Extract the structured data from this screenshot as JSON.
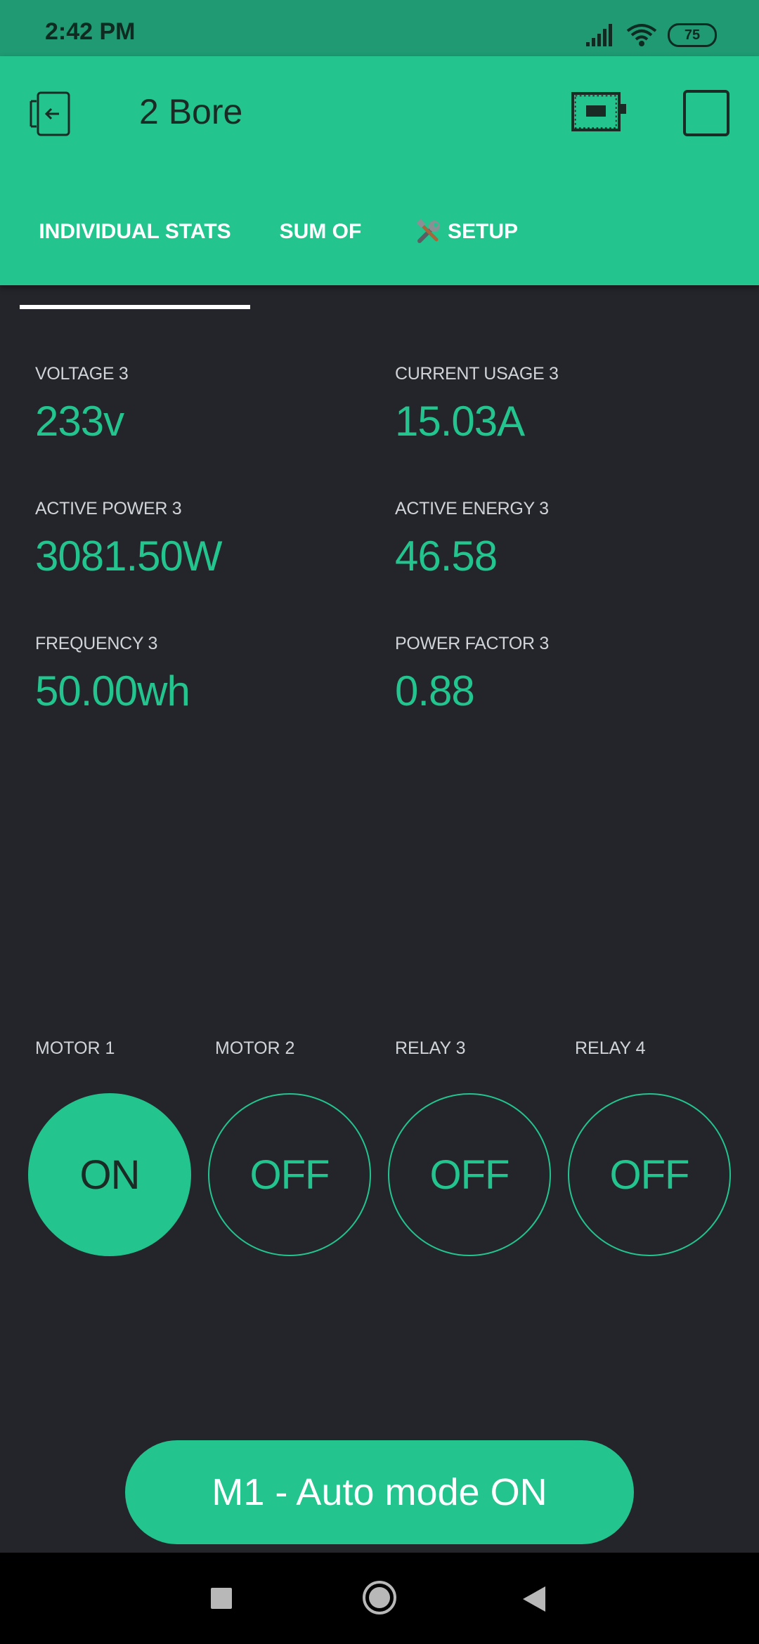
{
  "status_bar": {
    "time": "2:42 PM",
    "battery": "75",
    "icons": [
      "signal-icon",
      "wifi-icon",
      "battery-icon"
    ]
  },
  "header": {
    "title": "2 Bore",
    "back_icon": "back-icon",
    "device_icon": "device-icon",
    "square_icon": "square-icon"
  },
  "tabs": [
    {
      "label": "INDIVIDUAL STATS",
      "active": true
    },
    {
      "label": "SUM OF",
      "active": false
    },
    {
      "label": "SETUP",
      "icon": "tools-icon",
      "active": false
    }
  ],
  "stats": [
    {
      "label": "VOLTAGE 3",
      "value": "233v"
    },
    {
      "label": "CURRENT USAGE 3",
      "value": "15.03A"
    },
    {
      "label": "ACTIVE POWER 3",
      "value": "3081.50W"
    },
    {
      "label": "ACTIVE ENERGY 3",
      "value": "46.58"
    },
    {
      "label": "FREQUENCY 3",
      "value": "50.00wh"
    },
    {
      "label": "POWER FACTOR 3",
      "value": "0.88"
    }
  ],
  "switches": [
    {
      "label": "MOTOR 1",
      "state": "ON"
    },
    {
      "label": "MOTOR 2",
      "state": "OFF"
    },
    {
      "label": "RELAY 3",
      "state": "OFF"
    },
    {
      "label": "RELAY 4",
      "state": "OFF"
    }
  ],
  "auto_button": {
    "label": "M1 - Auto mode ON"
  },
  "colors": {
    "accent": "#23c48e",
    "status_bar": "#1f9a72",
    "background": "#23252a"
  },
  "nav": {
    "recent_icon": "recent-apps-icon",
    "home_icon": "home-icon",
    "back_icon": "nav-back-icon"
  }
}
